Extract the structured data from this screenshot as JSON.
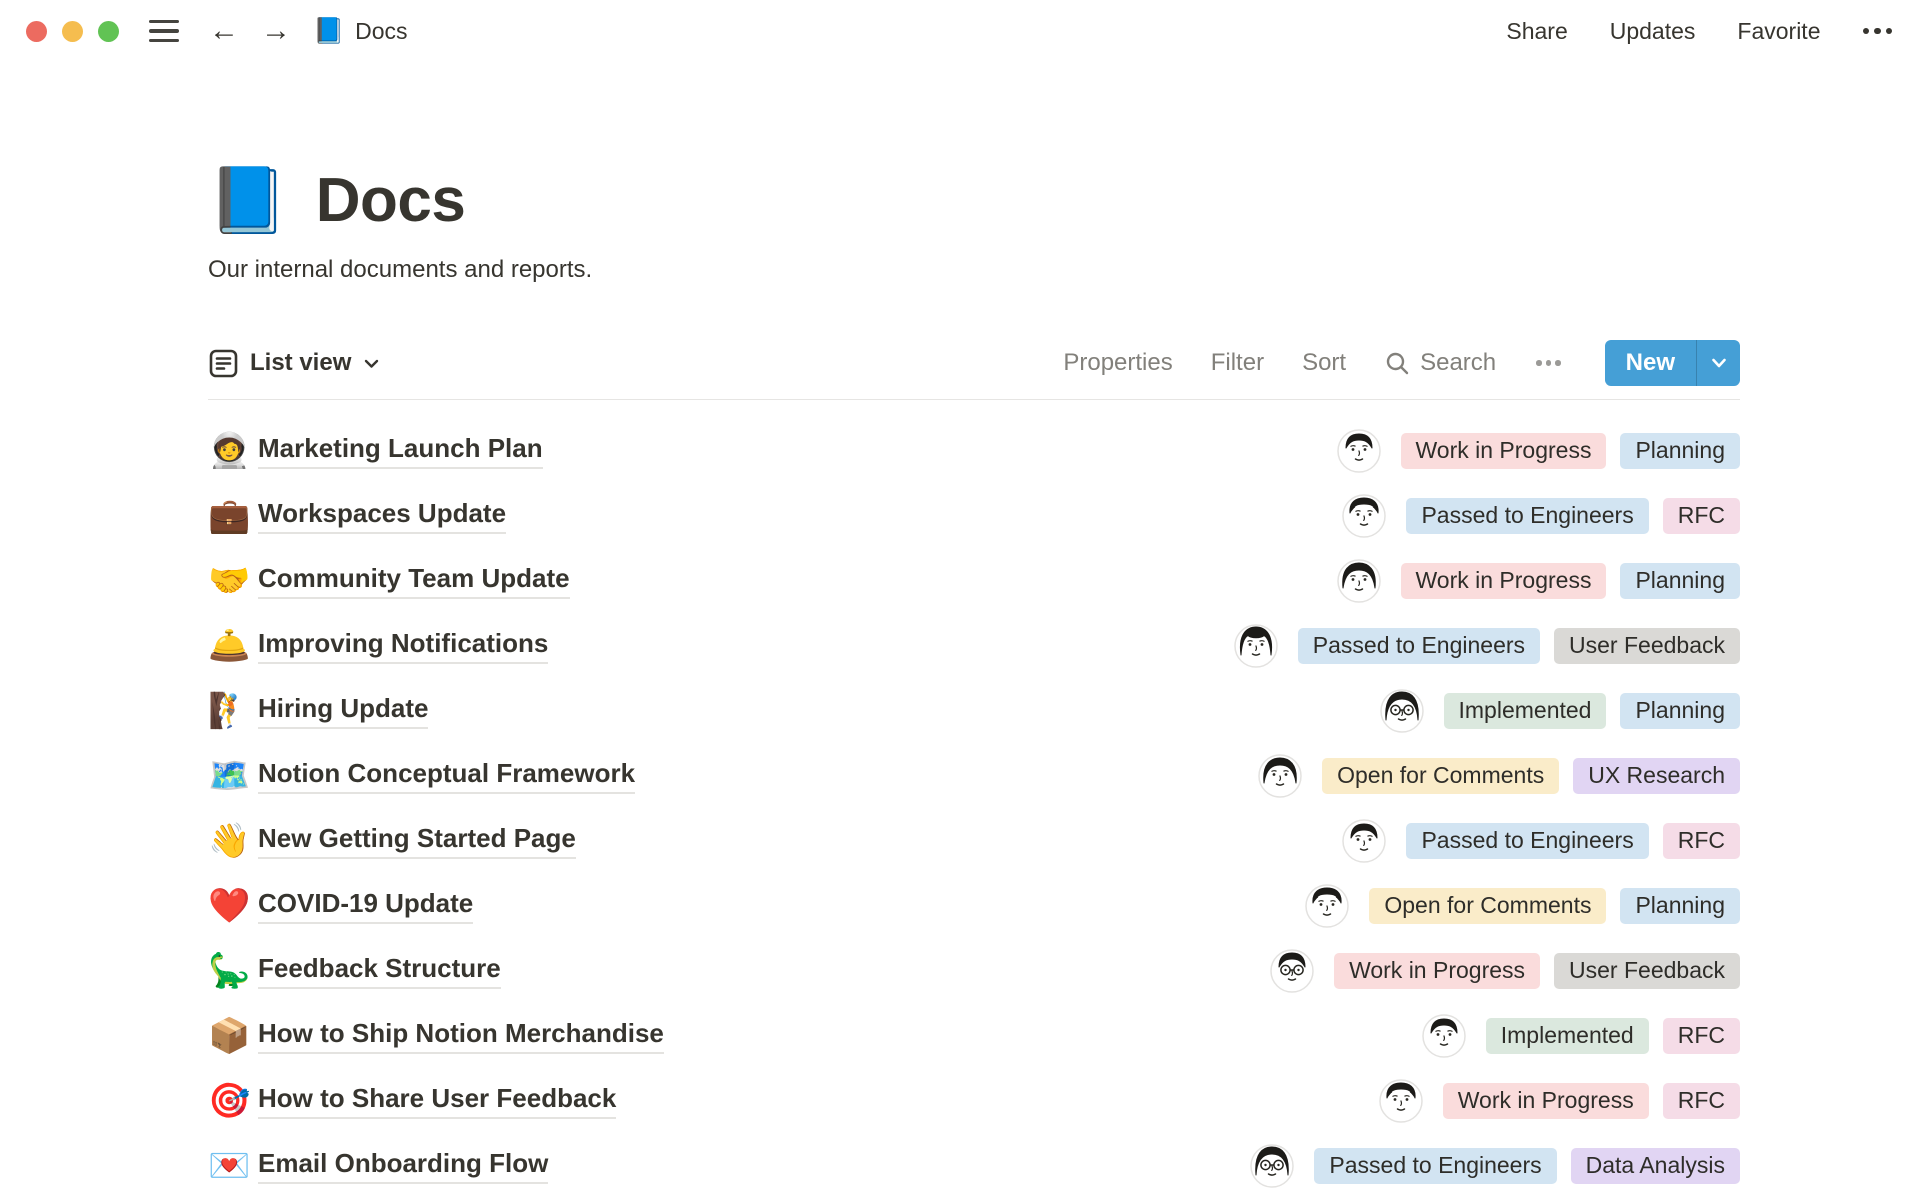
{
  "window": {
    "traffic_lights": [
      "#EC6B60",
      "#F5BD4F",
      "#61C354"
    ],
    "back_arrow": "←",
    "forward_arrow": "→",
    "doc_icon": "📘",
    "doc_title": "Docs",
    "menu": [
      "Share",
      "Updates",
      "Favorite"
    ]
  },
  "page": {
    "icon": "📘",
    "title": "Docs",
    "subtitle": "Our internal documents and reports."
  },
  "toolbar": {
    "view_label": "List view",
    "actions": [
      "Properties",
      "Filter",
      "Sort"
    ],
    "search_label": "Search",
    "new_label": "New",
    "accent_color": "#459FD6"
  },
  "rows": [
    {
      "emoji": "🧑‍🚀",
      "title": "Marketing Launch Plan",
      "avatar": "man1",
      "status": {
        "label": "Work in Progress",
        "bg": "#FADCDC"
      },
      "category": {
        "label": "Planning",
        "bg": "#D2E4F2"
      }
    },
    {
      "emoji": "💼",
      "title": "Workspaces Update",
      "avatar": "man2",
      "status": {
        "label": "Passed to Engineers",
        "bg": "#D2E4F2"
      },
      "category": {
        "label": "RFC",
        "bg": "#F5DCE7"
      }
    },
    {
      "emoji": "🤝",
      "title": "Community Team Update",
      "avatar": "woman1",
      "status": {
        "label": "Work in Progress",
        "bg": "#FADCDC"
      },
      "category": {
        "label": "Planning",
        "bg": "#D2E4F2"
      }
    },
    {
      "emoji": "🛎️",
      "title": "Improving Notifications",
      "avatar": "woman2",
      "status": {
        "label": "Passed to Engineers",
        "bg": "#D2E4F2"
      },
      "category": {
        "label": "User Feedback",
        "bg": "#DAD9D6"
      }
    },
    {
      "emoji": "🧗",
      "title": "Hiring Update",
      "avatar": "wglasses",
      "status": {
        "label": "Implemented",
        "bg": "#DBE8DE"
      },
      "category": {
        "label": "Planning",
        "bg": "#D2E4F2"
      }
    },
    {
      "emoji": "🗺️",
      "title": "Notion Conceptual Framework",
      "avatar": "woman1",
      "status": {
        "label": "Open for Comments",
        "bg": "#FAECC9"
      },
      "category": {
        "label": "UX Research",
        "bg": "#E1D5F3"
      }
    },
    {
      "emoji": "👋",
      "title": "New Getting Started Page",
      "avatar": "man1",
      "status": {
        "label": "Passed to Engineers",
        "bg": "#D2E4F2"
      },
      "category": {
        "label": "RFC",
        "bg": "#F5DCE7"
      }
    },
    {
      "emoji": "❤️",
      "title": "COVID-19 Update",
      "avatar": "man2",
      "status": {
        "label": "Open for Comments",
        "bg": "#FAECC9"
      },
      "category": {
        "label": "Planning",
        "bg": "#D2E4F2"
      }
    },
    {
      "emoji": "🦕",
      "title": "Feedback Structure",
      "avatar": "mglasses",
      "status": {
        "label": "Work in Progress",
        "bg": "#FADCDC"
      },
      "category": {
        "label": "User Feedback",
        "bg": "#DAD9D6"
      }
    },
    {
      "emoji": "📦",
      "title": "How to Ship Notion Merchandise",
      "avatar": "man1",
      "status": {
        "label": "Implemented",
        "bg": "#DBE8DE"
      },
      "category": {
        "label": "RFC",
        "bg": "#F5DCE7"
      }
    },
    {
      "emoji": "🎯",
      "title": "How to Share User Feedback",
      "avatar": "man2",
      "status": {
        "label": "Work in Progress",
        "bg": "#FADCDC"
      },
      "category": {
        "label": "RFC",
        "bg": "#F5DCE7"
      }
    },
    {
      "emoji": "💌",
      "title": "Email Onboarding Flow",
      "avatar": "wglasses",
      "status": {
        "label": "Passed to Engineers",
        "bg": "#D2E4F2"
      },
      "category": {
        "label": "Data Analysis",
        "bg": "#E1D5F3"
      }
    }
  ]
}
